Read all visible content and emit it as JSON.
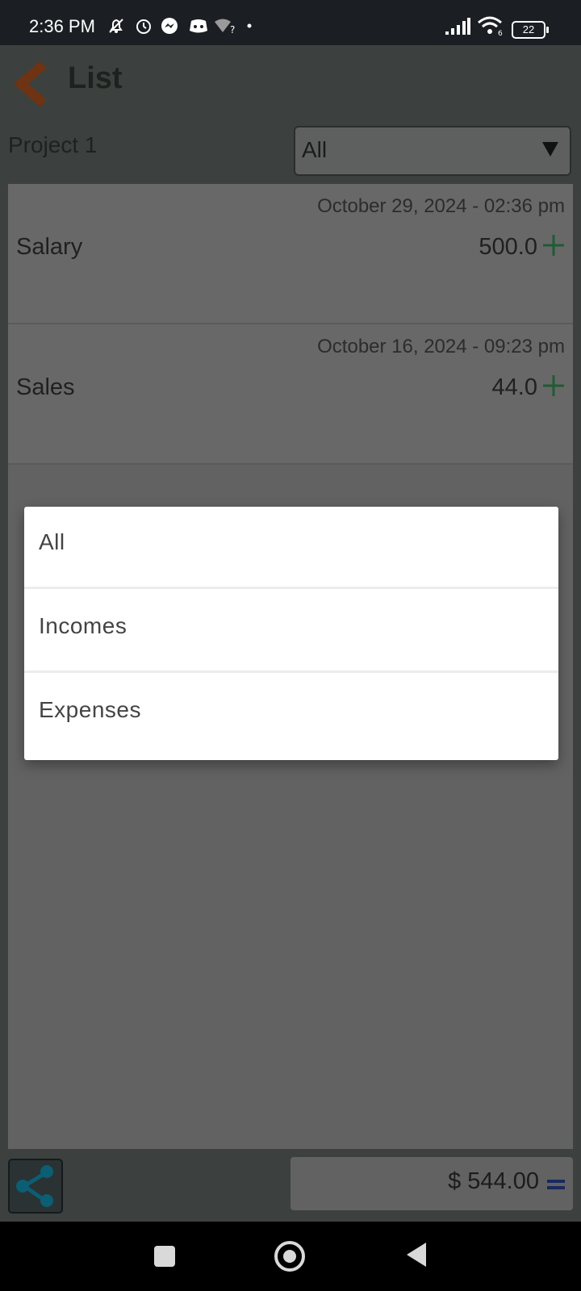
{
  "status_bar": {
    "time": "2:36 PM",
    "battery": "22",
    "icons": [
      "mute-bell-icon",
      "alarm-icon",
      "messenger-icon",
      "discord-icon",
      "wifi-question-icon",
      "dot-icon",
      "signal-icon",
      "wifi-icon"
    ]
  },
  "header": {
    "title": "List",
    "back_icon": "chevron-left-icon",
    "accent_color": "#b3531b"
  },
  "toolbar": {
    "project_label": "Project 1",
    "filter_value": "All"
  },
  "entries": [
    {
      "date": "October 29, 2024 - 02:36 pm",
      "name": "Salary",
      "amount": "500.0",
      "type_icon": "plus-icon"
    },
    {
      "date": "October 16, 2024 - 09:23 pm",
      "name": "Sales",
      "amount": "44.0",
      "type_icon": "plus-icon"
    }
  ],
  "footer": {
    "share_icon": "share-icon",
    "total": "$ 544.00",
    "equals_icon": "equals-icon"
  },
  "menu": {
    "items": [
      "All",
      "Incomes",
      "Expenses"
    ]
  },
  "nav": {
    "icons": [
      "recents-icon",
      "home-icon",
      "back-icon"
    ]
  }
}
